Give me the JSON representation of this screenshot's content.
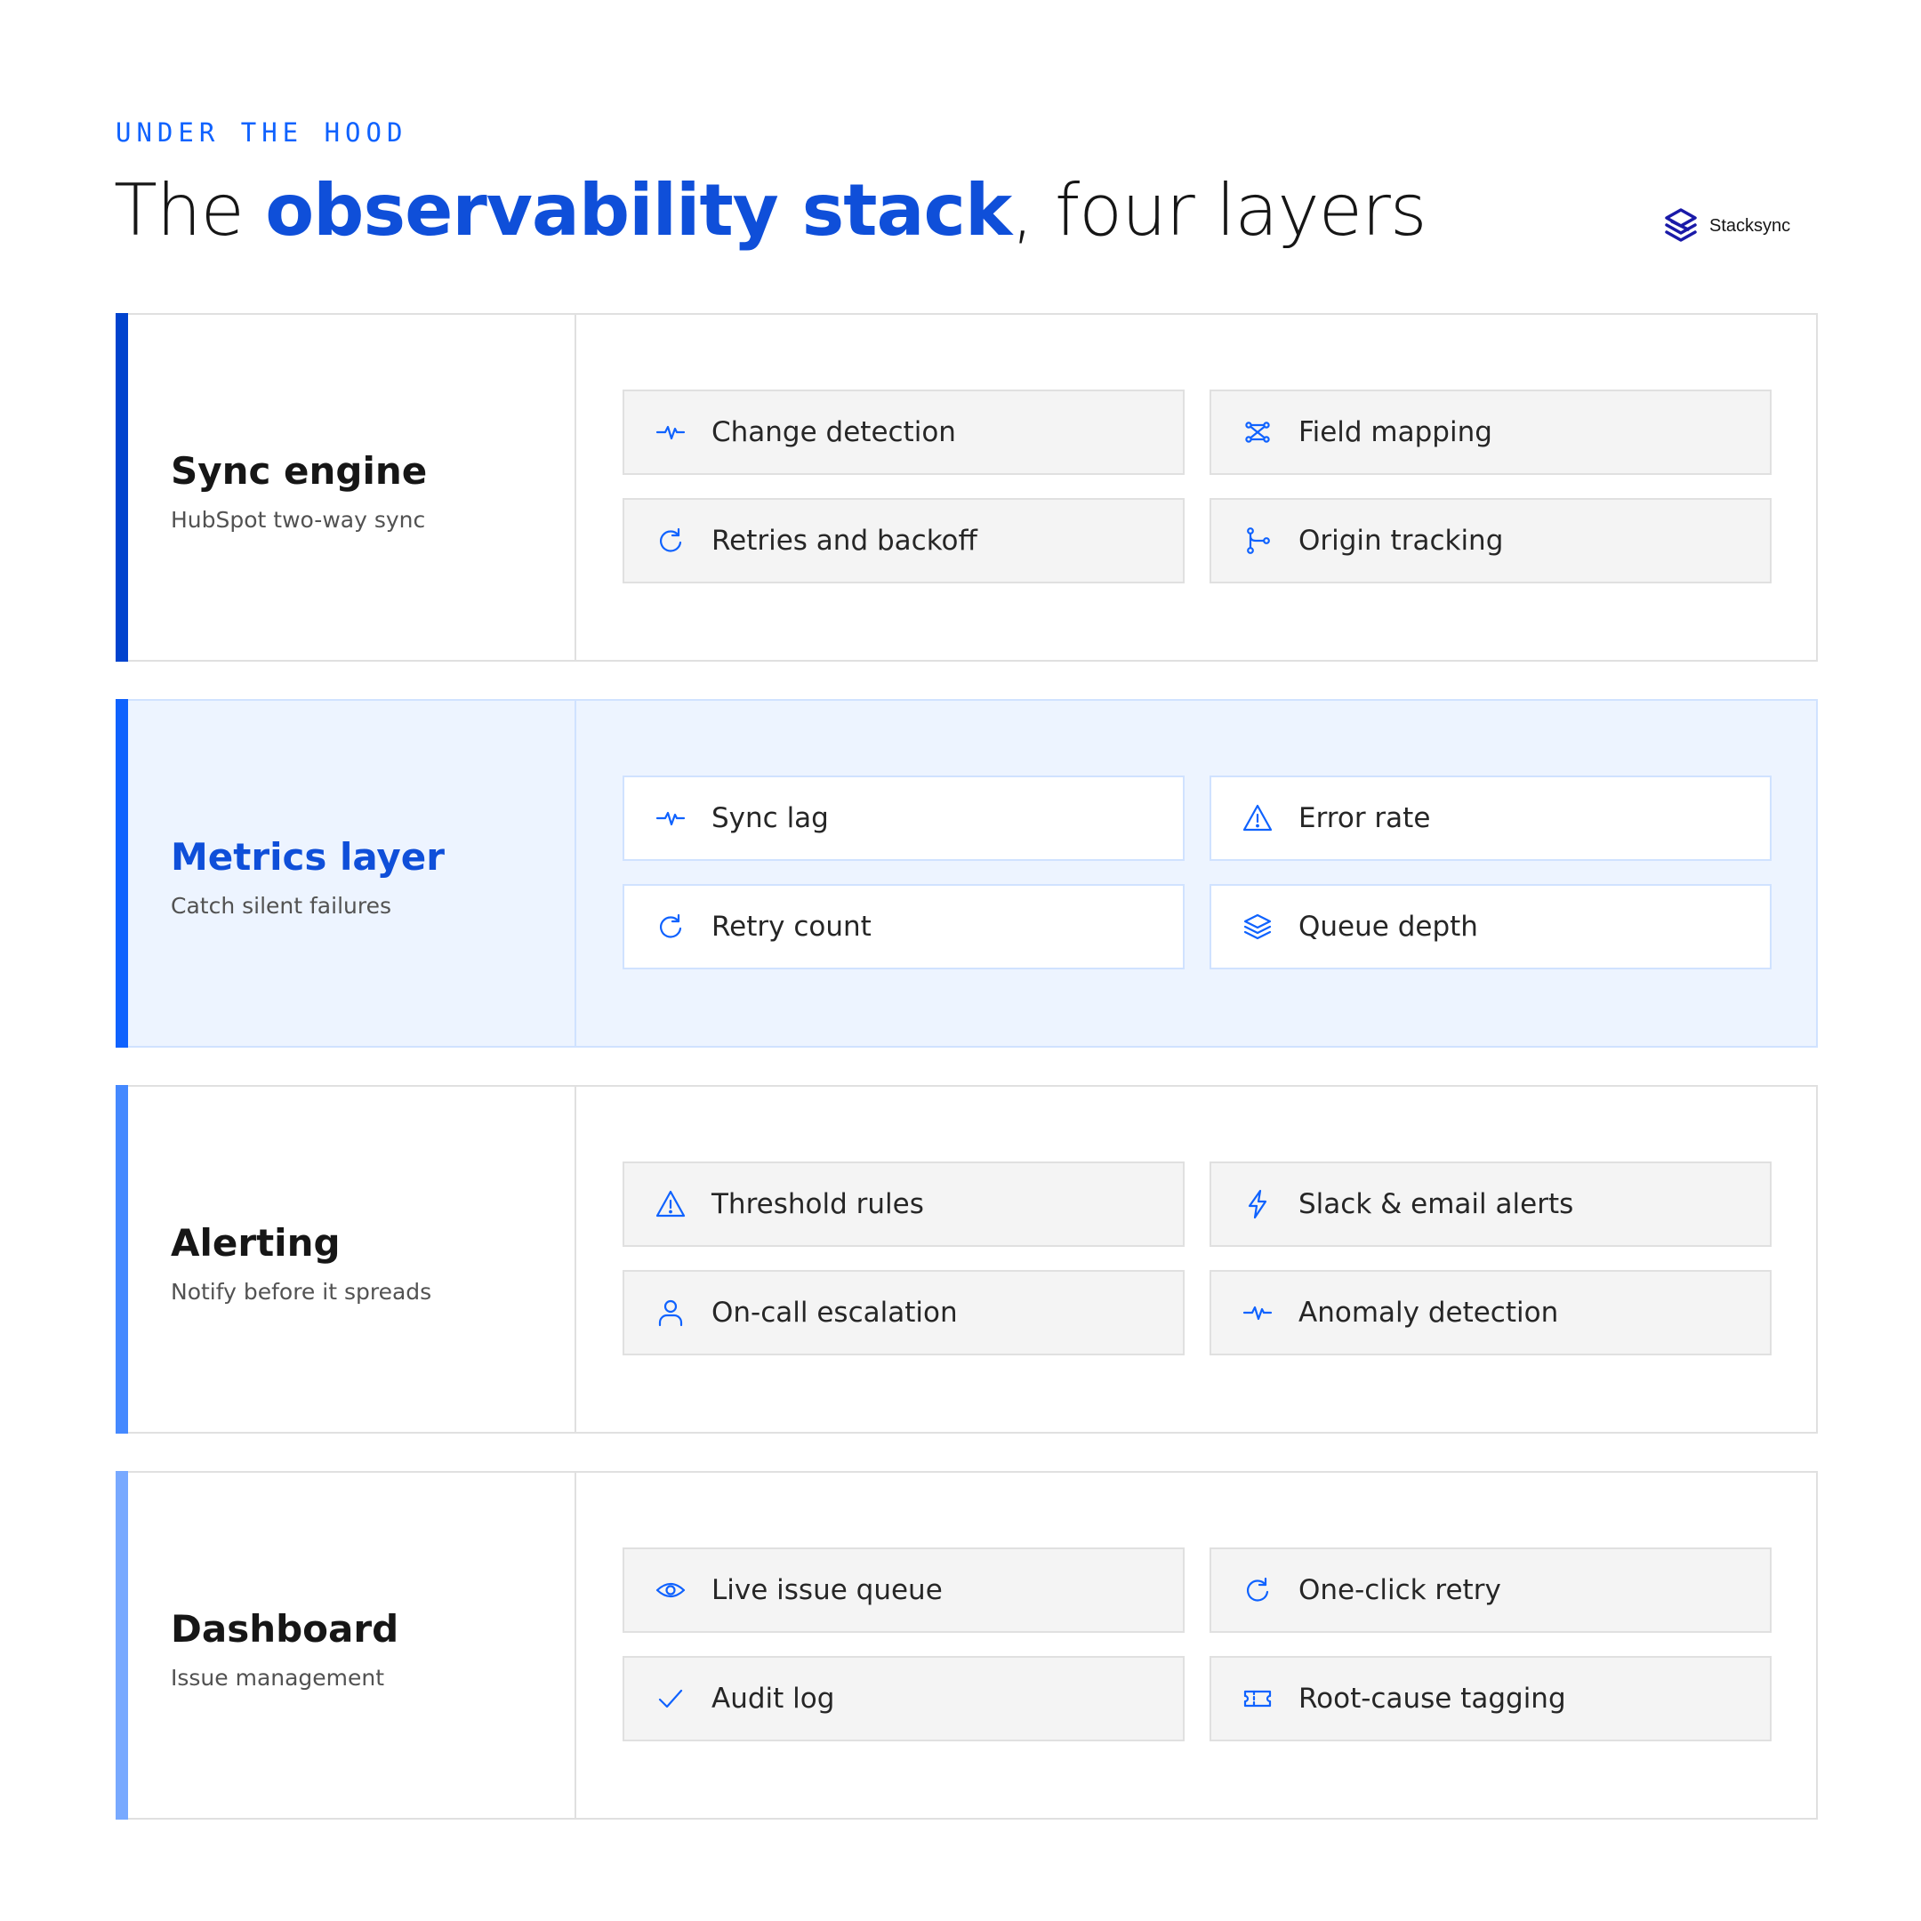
{
  "header": {
    "eyebrow": "UNDER THE HOOD",
    "title_pre": "The ",
    "title_accent": "observability stack",
    "title_post": ", four layers"
  },
  "brand": {
    "name": "Stacksync",
    "icon": "stacksync-logo-icon"
  },
  "colors": {
    "accent": "#0f62fe",
    "title_accent": "#0f4fd9",
    "stripes": [
      "#0043ce",
      "#0f62fe",
      "#4589ff",
      "#78a9ff"
    ],
    "active_background": "#edf4ff"
  },
  "layers": [
    {
      "title": "Sync engine",
      "subtitle": "HubSpot two-way sync",
      "capabilities": [
        {
          "label": "Change detection",
          "icon": "pulse-icon"
        },
        {
          "label": "Field mapping",
          "icon": "mapping-icon"
        },
        {
          "label": "Retries and backoff",
          "icon": "refresh-icon"
        },
        {
          "label": "Origin tracking",
          "icon": "branch-icon"
        }
      ]
    },
    {
      "title": "Metrics layer",
      "subtitle": "Catch silent failures",
      "capabilities": [
        {
          "label": "Sync lag",
          "icon": "pulse-icon"
        },
        {
          "label": "Error rate",
          "icon": "warning-icon"
        },
        {
          "label": "Retry count",
          "icon": "refresh-icon"
        },
        {
          "label": "Queue depth",
          "icon": "layers-icon"
        }
      ]
    },
    {
      "title": "Alerting",
      "subtitle": "Notify before it spreads",
      "capabilities": [
        {
          "label": "Threshold rules",
          "icon": "warning-icon"
        },
        {
          "label": "Slack & email alerts",
          "icon": "lightning-icon"
        },
        {
          "label": "On-call escalation",
          "icon": "user-icon"
        },
        {
          "label": "Anomaly detection",
          "icon": "pulse-icon"
        }
      ]
    },
    {
      "title": "Dashboard",
      "subtitle": "Issue management",
      "capabilities": [
        {
          "label": "Live issue queue",
          "icon": "eye-icon"
        },
        {
          "label": "One-click retry",
          "icon": "refresh-icon"
        },
        {
          "label": "Audit log",
          "icon": "check-icon"
        },
        {
          "label": "Root-cause tagging",
          "icon": "ticket-icon"
        }
      ]
    }
  ]
}
